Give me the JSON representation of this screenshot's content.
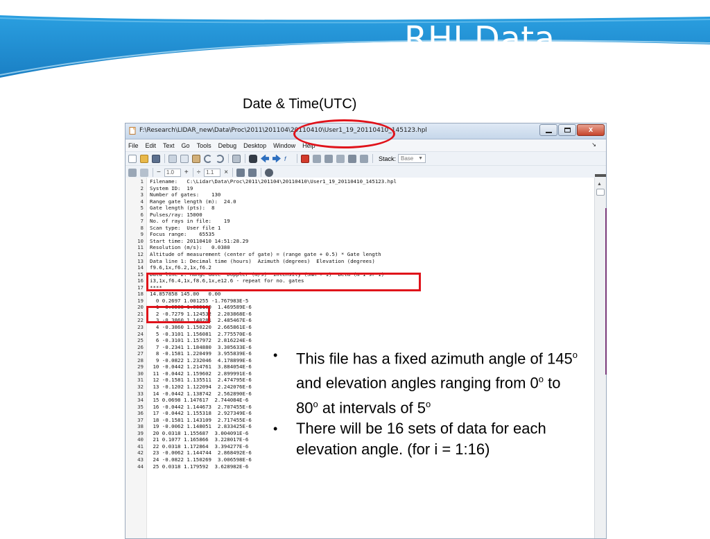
{
  "slide": {
    "title": "RHI Data",
    "date_label": "Date & Time(UTC)",
    "accent_color": "#1a93d6"
  },
  "window": {
    "title": "F:\\Research\\LIDAR_new\\Data\\Proc\\2011\\201104\\20110410\\User1_19_20110410_145123.hpl",
    "close_glyph": "x"
  },
  "menu": [
    "File",
    "Edit",
    "Text",
    "Go",
    "Tools",
    "Debug",
    "Desktop",
    "Window",
    "Help"
  ],
  "toolbar": {
    "stack_label": "Stack:",
    "stack_value": "Base"
  },
  "cellbar": {
    "value1": "1.0",
    "value2": "1.1",
    "minus": "−",
    "plus": "+",
    "divide": "÷",
    "times": "×"
  },
  "editor_lines": [
    {
      "n": "1",
      "t": "Filename:   C:\\Lidar\\Data\\Proc\\2011\\201104\\20110410\\User1_19_20110410_145123.hpl"
    },
    {
      "n": "2",
      "t": "System ID:  19"
    },
    {
      "n": "3",
      "t": "Number of gates:    130"
    },
    {
      "n": "4",
      "t": "Range gate length (m):  24.0"
    },
    {
      "n": "5",
      "t": "Gate length (pts):  8"
    },
    {
      "n": "6",
      "t": "Pulses/ray: 15000"
    },
    {
      "n": "7",
      "t": "No. of rays in file:    19"
    },
    {
      "n": "8",
      "t": "Scan type:  User file 1"
    },
    {
      "n": "9",
      "t": "Focus range:    65535"
    },
    {
      "n": "10",
      "t": "Start time: 20110410 14:51:28.29"
    },
    {
      "n": "11",
      "t": "Resolution (m/s):   0.0380"
    },
    {
      "n": "12",
      "t": "Altitude of measurement (center of gate) = (range gate + 0.5) * Gate length"
    },
    {
      "n": "13",
      "t": "Data line 1: Decimal time (hours)  Azimuth (degrees)  Elevation (degrees)"
    },
    {
      "n": "14",
      "t": "f9.6,1x,f6.2,1x,f6.2"
    },
    {
      "n": "15",
      "t": "Data line 2: Range Gate  Doppler (m/s)  Intensity (SNR + 1)  Beta (m-1 sr-1)"
    },
    {
      "n": "16",
      "t": "i3,1x,f6.4,1x,f8.6,1x,e12.6 - repeat for no. gates"
    },
    {
      "n": "17",
      "t": "****"
    },
    {
      "n": "18",
      "t": "14.857858 145.00   0.00"
    },
    {
      "n": "19",
      "t": "  0 0.2697 1.001255 -1.767983E-5"
    },
    {
      "n": "20",
      "t": "  1 -8.0588 1.083100  1.469589E-6"
    },
    {
      "n": "21",
      "t": "  2 -0.7279 1.124532  2.203868E-6"
    },
    {
      "n": "22",
      "t": "  3 -0.3860 1.140281  2.485467E-6"
    },
    {
      "n": "23",
      "t": "  4 -0.3860 1.150220  2.665861E-6"
    },
    {
      "n": "24",
      "t": "  5 -0.3101 1.156081  2.775570E-6"
    },
    {
      "n": "25",
      "t": "  6 -0.3101 1.157972  2.816224E-6"
    },
    {
      "n": "26",
      "t": "  7 -0.2341 1.184880  3.305633E-6"
    },
    {
      "n": "27",
      "t": "  8 -0.1581 1.220499  3.955839E-6"
    },
    {
      "n": "28",
      "t": "  9 -0.0822 1.232046  4.178899E-6"
    },
    {
      "n": "29",
      "t": " 10 -0.0442 1.214761  3.884054E-6"
    },
    {
      "n": "30",
      "t": " 11 -0.0442 1.159602  2.899991E-6"
    },
    {
      "n": "31",
      "t": " 12 -0.1581 1.135511  2.474795E-6"
    },
    {
      "n": "32",
      "t": " 13 -0.1202 1.122094  2.242076E-6"
    },
    {
      "n": "33",
      "t": " 14 -0.0442 1.138742  2.562890E-6"
    },
    {
      "n": "34",
      "t": " 15 0.0698 1.147617  2.744084E-6"
    },
    {
      "n": "35",
      "t": " 16 -0.0442 1.144673  2.707455E-6"
    },
    {
      "n": "36",
      "t": " 17 -0.0442 1.155318  2.927349E-6"
    },
    {
      "n": "37",
      "t": " 18 -0.1581 1.143109  2.717455E-6"
    },
    {
      "n": "38",
      "t": " 19 -0.0062 1.148051  2.833425E-6"
    },
    {
      "n": "39",
      "t": " 20 0.0318 1.155687  3.004091E-6"
    },
    {
      "n": "40",
      "t": " 21 0.1077 1.165866  3.228017E-6"
    },
    {
      "n": "41",
      "t": " 22 0.0318 1.172864  3.394277E-6"
    },
    {
      "n": "42",
      "t": " 23 -0.0062 1.144744  2.868492E-6"
    },
    {
      "n": "43",
      "t": " 24 -0.0822 1.150269  3.006598E-6"
    },
    {
      "n": "44",
      "t": " 25 0.0318 1.179592  3.628982E-6"
    }
  ],
  "bullets": [
    {
      "pre": "This file has a fixed azimuth angle of 145",
      "sup1": "o",
      "mid1": " and elevation angles ranging from 0",
      "sup2": "o",
      "mid2": " to 80",
      "sup3": "o",
      "post": " at intervals of 5",
      "sup4": "o"
    },
    {
      "text": "There will be 16 sets of data for each elevation angle. (for i = 1:16)"
    }
  ]
}
